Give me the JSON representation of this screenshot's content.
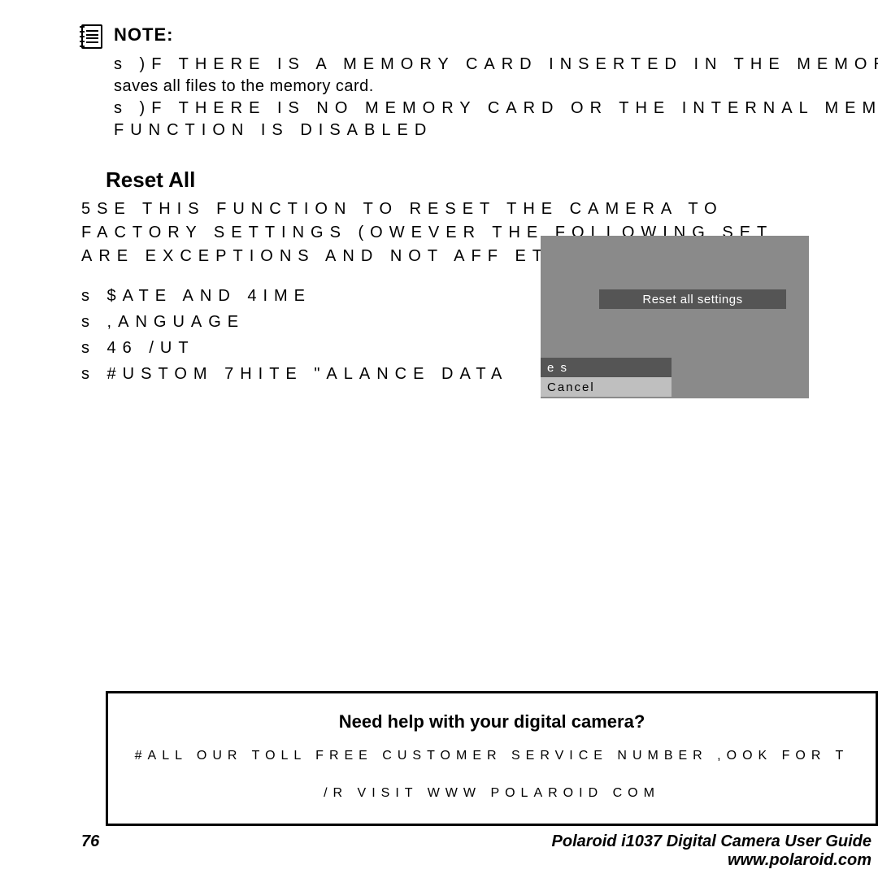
{
  "note": {
    "title": "NOTE:",
    "line1a": "s )F THERE IS A MEMORY CARD INSERTED IN THE MEMOR",
    "line1b": "saves all files to the memory card.",
    "line2a": "s )F THERE IS NO MEMORY CARD OR THE INTERNAL MEM",
    "line2b": "FUNCTION IS DISABLED"
  },
  "reset": {
    "title": "Reset All",
    "body1": "5SE THIS FUNCTION TO RESET THE CAMERA TO",
    "body2": "FACTORY SETTINGS (OWEVER THE FOLLOWING SET",
    "body3": "ARE EXCEPTIONS AND NOT AFF              ET",
    "bullets": [
      "s  $ATE AND 4IME",
      "s  ,ANGUAGE",
      "s  46 /UT",
      "s  #USTOM 7HITE \"ALANCE DATA"
    ]
  },
  "camera_ui": {
    "label": "Reset all settings",
    "option_yes": "e s",
    "option_cancel": "Cancel"
  },
  "help": {
    "question": "Need help with your digital camera?",
    "line1": "#ALL OUR TOLL FREE CUSTOMER SERVICE NUMBER ,OOK FOR T",
    "line2": "/R VISIT WWW POLAROID COM"
  },
  "footer": {
    "page": "76",
    "guide": "Polaroid i1037 Digital Camera User Guide",
    "url": "www.polaroid.com"
  }
}
